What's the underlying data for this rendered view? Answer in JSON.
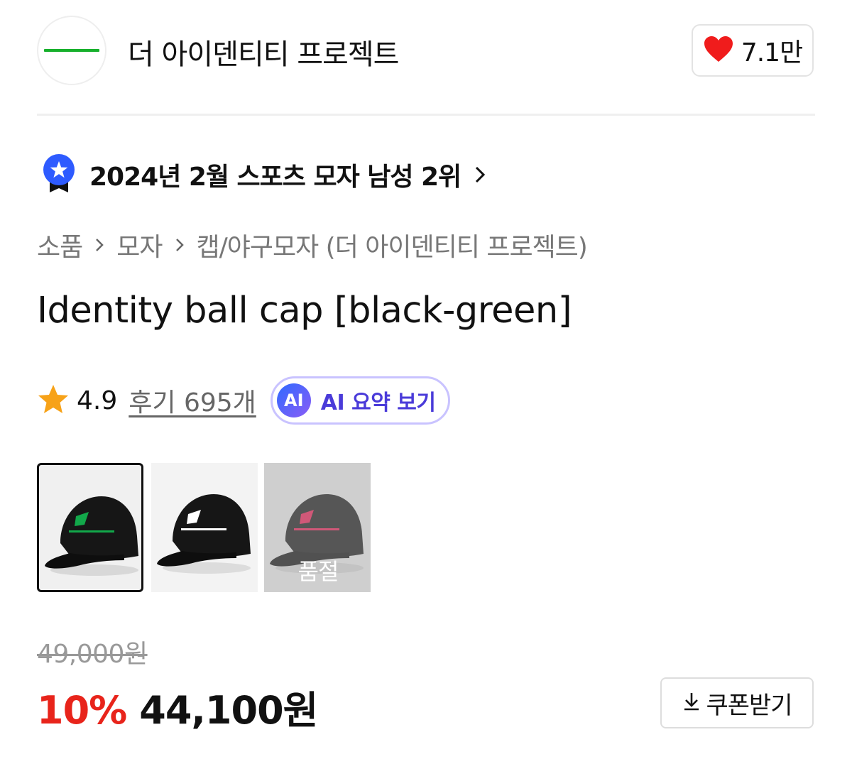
{
  "brand": {
    "name": "더 아이덴티티 프로젝트",
    "like_count": "7.1만",
    "logo_color": "#17b02c"
  },
  "ranking": {
    "text": "2024년 2월 스포츠 모자 남성 2위",
    "badge_color": "#2e5bff"
  },
  "breadcrumb": {
    "items": [
      "소품",
      "모자",
      "캡/야구모자 (더 아이덴티티 프로젝트)"
    ]
  },
  "product": {
    "title": "Identity ball cap [black-green]",
    "rating": "4.9",
    "reviews_label": "후기 695개",
    "ai_badge": "AI",
    "ai_summary_label": "AI 요약 보기"
  },
  "options": [
    {
      "color": "black-green",
      "logo_color": "#12a84a",
      "selected": true,
      "sold_out": false
    },
    {
      "color": "black-white",
      "logo_color": "#ffffff",
      "selected": false,
      "sold_out": false
    },
    {
      "color": "black-red",
      "logo_color": "#d11a4a",
      "selected": false,
      "sold_out": true,
      "sold_out_label": "품절"
    }
  ],
  "price": {
    "original": "49,000원",
    "discount": "10%",
    "final": "44,100원",
    "discount_color": "#e8241b"
  },
  "coupon": {
    "label": "쿠폰받기"
  }
}
